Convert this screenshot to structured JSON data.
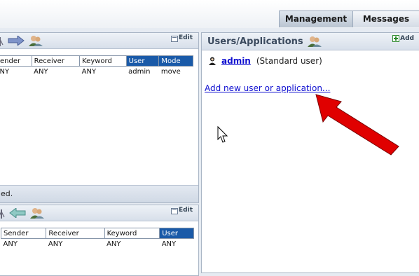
{
  "tabs": [
    {
      "label": "Management",
      "active": true
    },
    {
      "label": "Messages",
      "active": false
    }
  ],
  "rules_panel_1": {
    "edit_label": "Edit",
    "columns": [
      "ender",
      "Receiver",
      "Keyword",
      "User",
      "Mode"
    ],
    "selected_columns": [
      "User",
      "Mode"
    ],
    "rows": [
      [
        "NY",
        "ANY",
        "ANY",
        "admin",
        "move"
      ]
    ],
    "status_text": "ed."
  },
  "rules_panel_2": {
    "edit_label": "Edit",
    "columns": [
      "Sender",
      "Receiver",
      "Keyword",
      "User"
    ],
    "selected_columns": [
      "User"
    ],
    "rows": [
      [
        "ANY",
        "ANY",
        "ANY",
        "ANY"
      ]
    ]
  },
  "users_panel": {
    "title": "Users/Applications",
    "add_label": "Add",
    "users": [
      {
        "name": "admin",
        "role": "(Standard user)"
      }
    ],
    "add_new_link": "Add new user or application..."
  },
  "icons": {
    "panel1": [
      "antenna-icon",
      "arrow-right-icon",
      "users-icon"
    ],
    "panel2": [
      "antenna-icon",
      "arrow-left-icon",
      "users-icon"
    ],
    "users_title": "users-icon",
    "user_row": "user-icon"
  },
  "colors": {
    "selected_header": "#1a5aa8",
    "link": "#1010d0",
    "annotation_arrow": "#e00000"
  }
}
